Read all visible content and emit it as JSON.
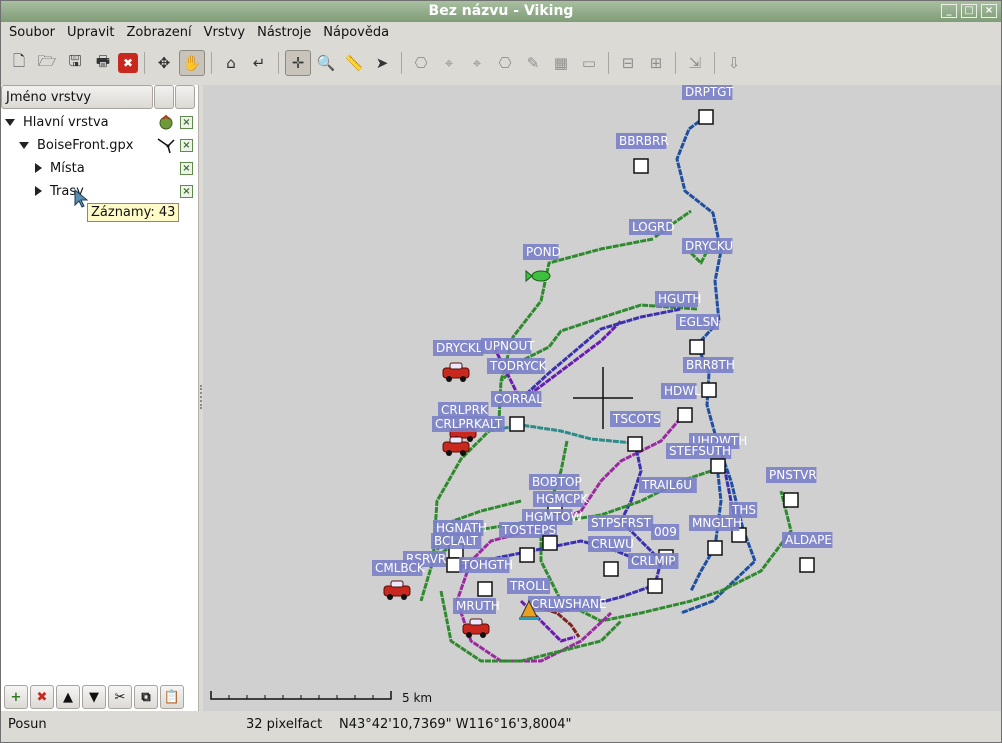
{
  "window": {
    "title": "Bez názvu - Viking",
    "controls": [
      "_",
      "□",
      "×"
    ]
  },
  "menu": [
    "Soubor",
    "Upravit",
    "Zobrazení",
    "Vrstvy",
    "Nástroje",
    "Nápověda"
  ],
  "toolbar": {
    "buttons": [
      {
        "name": "new-icon",
        "active": false,
        "disabled": false
      },
      {
        "name": "open-icon",
        "active": false,
        "disabled": false
      },
      {
        "name": "save-icon",
        "active": false,
        "disabled": false
      },
      {
        "name": "print-icon",
        "active": false,
        "disabled": false
      },
      {
        "name": "close-icon",
        "active": false,
        "disabled": false
      },
      {
        "sep": true
      },
      {
        "name": "pan-tool-icon",
        "active": false,
        "disabled": false
      },
      {
        "name": "hand-tool-icon",
        "active": true,
        "disabled": false
      },
      {
        "sep": true
      },
      {
        "name": "home-icon",
        "active": false,
        "disabled": false
      },
      {
        "name": "goto-icon",
        "active": false,
        "disabled": false
      },
      {
        "sep": true
      },
      {
        "name": "move-tool-icon",
        "active": true,
        "disabled": false
      },
      {
        "name": "zoom-tool-icon",
        "active": false,
        "disabled": false
      },
      {
        "name": "ruler-tool-icon",
        "active": false,
        "disabled": false
      },
      {
        "name": "select-tool-icon",
        "active": false,
        "disabled": false
      },
      {
        "sep": true
      },
      {
        "name": "track-create-icon",
        "active": false,
        "disabled": true
      },
      {
        "name": "route-create-icon",
        "active": false,
        "disabled": true
      },
      {
        "name": "waypoint-create-icon",
        "active": false,
        "disabled": true
      },
      {
        "name": "track-edit-icon",
        "active": false,
        "disabled": true
      },
      {
        "name": "waypoint-edit-icon",
        "active": false,
        "disabled": true
      },
      {
        "name": "route-finder-icon",
        "active": false,
        "disabled": true
      },
      {
        "name": "show-picture-icon",
        "active": false,
        "disabled": true
      },
      {
        "sep": true
      },
      {
        "name": "georef-move-icon",
        "active": false,
        "disabled": true
      },
      {
        "name": "georef-zoom-icon",
        "active": false,
        "disabled": true
      },
      {
        "sep": true
      },
      {
        "name": "map-download-icon",
        "active": false,
        "disabled": true
      },
      {
        "sep": true
      },
      {
        "name": "dem-download-icon",
        "active": false,
        "disabled": true
      }
    ]
  },
  "layers": {
    "header": "Jméno vrstvy",
    "rows": [
      {
        "label": "Hlavní vrstva",
        "expander": "down",
        "indent": 0,
        "icon": "aggregate-layer-icon"
      },
      {
        "label": "BoiseFront.gpx",
        "expander": "down",
        "indent": 1,
        "icon": "trw-layer-icon"
      },
      {
        "label": "Místa",
        "expander": "right",
        "indent": 2,
        "icon": ""
      },
      {
        "label": "Trasy",
        "expander": "right",
        "indent": 2,
        "icon": ""
      }
    ],
    "tooltip": "Záznamy: 43",
    "bottom_buttons": [
      "add-layer-icon",
      "remove-layer-icon",
      "move-up-icon",
      "move-down-icon",
      "cut-icon",
      "copy-icon",
      "paste-icon"
    ]
  },
  "map": {
    "scale_label": "5 km",
    "waypoints": [
      "DRPTGT",
      "BBRBRR",
      "LOGRD",
      "DRYCKU",
      "POND",
      "HGUTH",
      "EGLSN",
      "DRYCKL",
      "UPNOUT",
      "TODRYCK",
      "BRR8TH",
      "CORRAL",
      "HDWL",
      "CRLPRK",
      "CRLPRKALT",
      "TSCOTS",
      "UHDWTH",
      "STEFSUTH",
      "PNSTVR",
      "TRAIL6U",
      "BOBTOP",
      "HGMCPK",
      "THS",
      "HGNATH",
      "HGMTOW",
      "TOSTEPS",
      "STPSFRST",
      "MNGLTH",
      "ALDAPE",
      "BCLALT",
      "009",
      "CRLWU",
      "RSRVR",
      "TOHGTH",
      "CRLMIP",
      "CMLBCK",
      "TROLL",
      "CRLWSHANE",
      "MRUTH"
    ]
  },
  "status": {
    "mode": "Posun",
    "zoom": "32 pixelfact",
    "position": "N43°42'10,7369\" W116°16'3,8004\""
  }
}
